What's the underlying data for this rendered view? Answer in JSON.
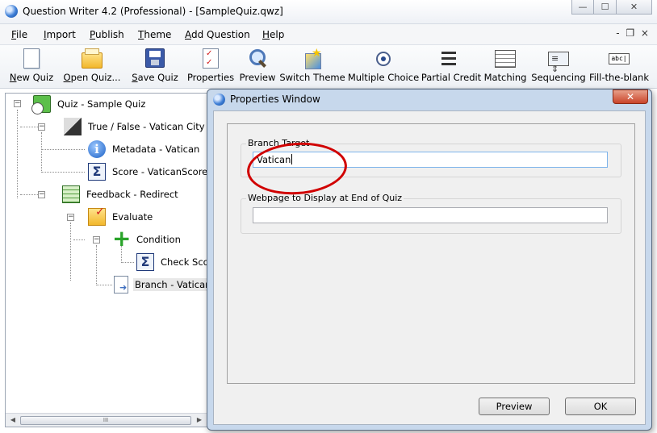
{
  "window": {
    "title": "Question Writer 4.2 (Professional) - [SampleQuiz.qwz]",
    "controls": {
      "minimize": "—",
      "maximize": "☐",
      "close": "✕"
    }
  },
  "menu": {
    "items": [
      {
        "accel": "F",
        "rest": "ile"
      },
      {
        "accel": "I",
        "rest": "mport"
      },
      {
        "accel": "P",
        "rest": "ublish"
      },
      {
        "accel": "T",
        "rest": "heme"
      },
      {
        "accel": "A",
        "rest": "dd Question"
      },
      {
        "accel": "H",
        "rest": "elp"
      }
    ],
    "mdi_controls": "- ❐ ×"
  },
  "toolbar": {
    "buttons": [
      {
        "accel": "N",
        "rest": "ew Quiz",
        "icon": "new-page-icon"
      },
      {
        "accel": "O",
        "rest": "pen Quiz...",
        "icon": "open-folder-icon"
      },
      {
        "accel": "S",
        "rest": "ave Quiz",
        "icon": "save-disk-icon"
      },
      {
        "accel": "",
        "rest": "Properties",
        "icon": "properties-icon"
      },
      {
        "accel": "",
        "rest": "Preview",
        "icon": "magnifier-icon"
      },
      {
        "accel": "",
        "rest": "Switch Theme",
        "icon": "magic-wand-icon"
      },
      {
        "accel": "",
        "rest": "Multiple Choice",
        "icon": "radio-button-icon"
      },
      {
        "accel": "",
        "rest": "Partial Credit",
        "icon": "partial-credit-icon"
      },
      {
        "accel": "",
        "rest": "Matching",
        "icon": "matching-grid-icon"
      },
      {
        "accel": "",
        "rest": "Sequencing",
        "icon": "sequencing-icon"
      },
      {
        "accel": "",
        "rest": "Fill-the-blank",
        "icon": "fill-blank-icon",
        "icon_text": "abc|"
      }
    ]
  },
  "tree": {
    "nodes": [
      {
        "label": "Quiz - Sample Quiz",
        "icon": "quiz-clock-icon"
      },
      {
        "label": "True / False - Vatican City is ent",
        "icon": "true-false-icon"
      },
      {
        "label": "Metadata - Vatican",
        "icon": "info-icon"
      },
      {
        "label": "Score - VaticanScore",
        "icon": "sigma-icon"
      },
      {
        "label": "Feedback - Redirect",
        "icon": "feedback-icon"
      },
      {
        "label": "Evaluate",
        "icon": "evaluate-folder-icon"
      },
      {
        "label": "Condition",
        "icon": "plus-icon"
      },
      {
        "label": "Check Scor",
        "icon": "sigma-icon"
      },
      {
        "label": "Branch - Vatican",
        "icon": "branch-icon",
        "selected": true
      }
    ],
    "scroll_grip": "III"
  },
  "properties": {
    "title": "Properties Window",
    "close": "✕",
    "branch_target": {
      "label": "Branch Target",
      "value": "Vatican"
    },
    "end_webpage": {
      "label": "Webpage to Display at End of Quiz",
      "value": ""
    },
    "preview_button": "Preview",
    "ok_button": "OK"
  }
}
